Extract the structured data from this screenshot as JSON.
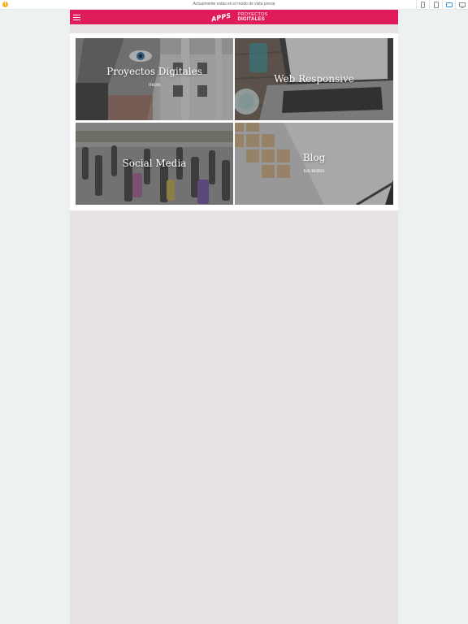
{
  "preview_bar": {
    "message": "Actualmente estás en el modo de vista previa",
    "warning_icon": "warning-icon",
    "devices": [
      "phone-portrait-icon",
      "tablet-portrait-icon",
      "tablet-landscape-icon",
      "desktop-icon"
    ],
    "active_device": "tablet-landscape-icon",
    "active_color": "#2b8fd6"
  },
  "app": {
    "brand_color": "#df1b5a",
    "menu_icon": "hamburger-menu-icon",
    "logo": {
      "apps": "APPS",
      "line1": "PROYECTOS",
      "line2": "DIGITALES"
    }
  },
  "tiles": [
    {
      "title": "Proyectos Digitales",
      "subtitle": "Inicio"
    },
    {
      "title": "Web Responsive",
      "subtitle": ""
    },
    {
      "title": "Social Media",
      "subtitle": ""
    },
    {
      "title": "Blog",
      "subtitle": "tus textos"
    }
  ]
}
